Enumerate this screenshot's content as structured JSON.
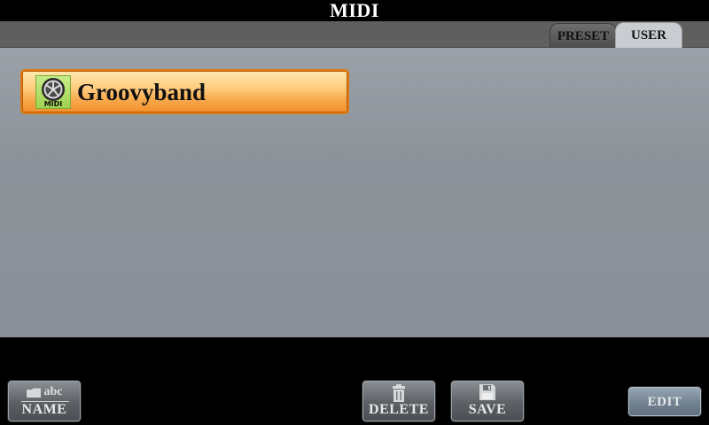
{
  "window": {
    "title": "MIDI"
  },
  "tabs": [
    {
      "label": "PRESET",
      "selected": false
    },
    {
      "label": "USER",
      "selected": true
    }
  ],
  "files": [
    {
      "name": "Groovyband",
      "icon": "midi-file-icon",
      "icon_label": "MIDI",
      "selected": true
    }
  ],
  "buttons": {
    "name": {
      "label": "NAME",
      "icon": "folder-icon",
      "icon_text": "abc"
    },
    "delete": {
      "label": "DELETE",
      "icon": "trash-icon"
    },
    "save": {
      "label": "SAVE",
      "icon": "floppy-disk-icon"
    },
    "edit": {
      "label": "EDIT"
    }
  },
  "colors": {
    "selected_item": "#f7a94b",
    "selected_border": "#e07a10",
    "file_area": "#8b9299",
    "midi_icon": "#9ed24f"
  }
}
